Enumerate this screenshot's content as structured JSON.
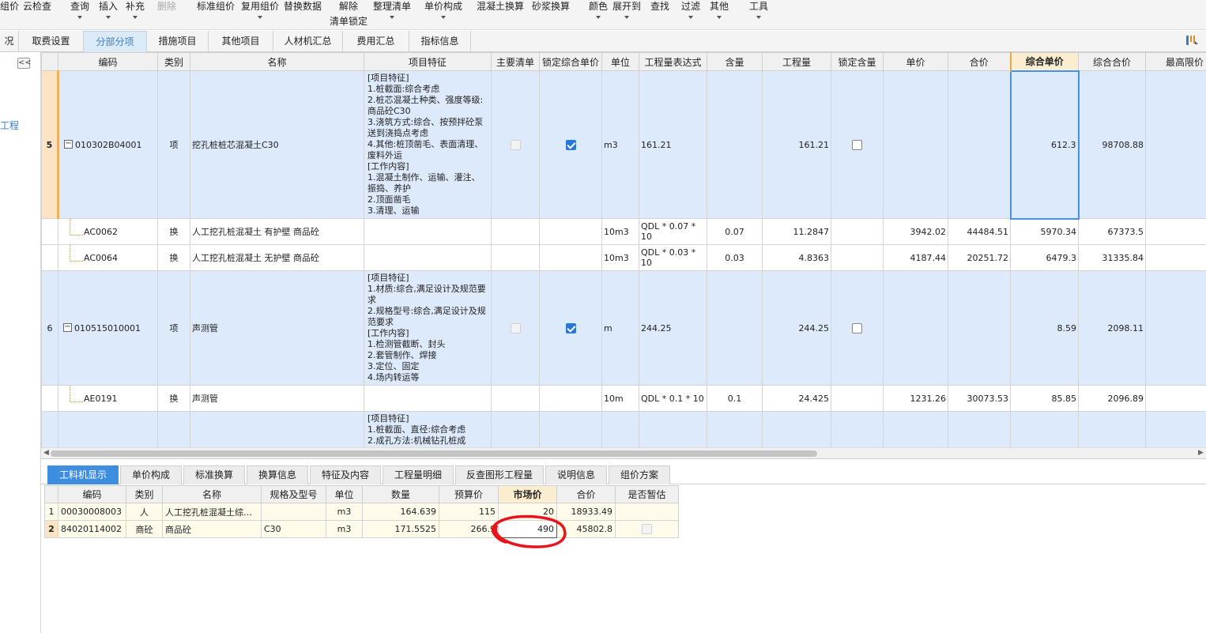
{
  "toolbar": {
    "items": [
      {
        "label": "组价",
        "dropdown": false,
        "disabled": false
      },
      {
        "label": "云检查",
        "dropdown": false,
        "disabled": false
      },
      {
        "label": "查询",
        "dropdown": true,
        "disabled": false
      },
      {
        "label": "插入",
        "dropdown": true,
        "disabled": false
      },
      {
        "label": "补充",
        "dropdown": true,
        "disabled": false
      },
      {
        "label": "删除",
        "dropdown": false,
        "disabled": true
      },
      {
        "label": "标准组价",
        "dropdown": false,
        "disabled": false
      },
      {
        "label": "复用组价",
        "dropdown": true,
        "disabled": false
      },
      {
        "label": "替换数据",
        "dropdown": false,
        "disabled": false
      },
      {
        "label": "解除",
        "dropdown": false,
        "disabled": false
      },
      {
        "label": "整理清单",
        "dropdown": true,
        "disabled": false
      },
      {
        "label": "单价构成",
        "dropdown": true,
        "disabled": false
      },
      {
        "label": "混凝土换算",
        "dropdown": false,
        "disabled": false
      },
      {
        "label": "砂浆换算",
        "dropdown": false,
        "disabled": false
      },
      {
        "label": "颜色",
        "dropdown": true,
        "disabled": false
      },
      {
        "label": "展开到",
        "dropdown": true,
        "disabled": false
      },
      {
        "label": "查找",
        "dropdown": false,
        "disabled": false
      },
      {
        "label": "过滤",
        "dropdown": true,
        "disabled": false
      },
      {
        "label": "其他",
        "dropdown": true,
        "disabled": false
      },
      {
        "label": "工具",
        "dropdown": true,
        "disabled": false
      }
    ],
    "unlock_line2": "清单锁定"
  },
  "tabs": [
    "况",
    "取费设置",
    "分部分项",
    "措施项目",
    "其他项目",
    "人材机汇总",
    "费用汇总",
    "指标信息"
  ],
  "active_tab": "分部分项",
  "left_panel": {
    "collapse": "<<",
    "text": "工程"
  },
  "main_headers": [
    "",
    "编码",
    "类别",
    "名称",
    "项目特征",
    "主要清单",
    "锁定综合单价",
    "单位",
    "工程量表达式",
    "含量",
    "工程量",
    "锁定含量",
    "单价",
    "合价",
    "综合单价",
    "综合合价",
    "最高限价"
  ],
  "rows": [
    {
      "rn": "5",
      "code": "010302B04001",
      "type": "项",
      "name": "挖孔桩桩芯混凝土C30",
      "feature": "[项目特征]\n1.桩截面:综合考虑\n2.桩芯混凝土种类、强度等级:商品砼C30\n3.浇筑方式:综合、按预拌砼泵送到浇捣点考虑\n4.其他:桩顶凿毛、表面清理、废料外运\n[工作内容]\n1.混凝土制作、运输、灌注、振捣、养护\n2.顶面凿毛\n3.清理、运输",
      "unit": "m3",
      "expr": "161.21",
      "content": "",
      "qty": "161.21",
      "price": "",
      "total": "",
      "unit_price": "612.3",
      "unit_total": "98708.88",
      "max": ""
    },
    {
      "rn": "",
      "code": "AC0062",
      "type": "换",
      "name": "人工挖孔桩混凝土 有护壁 商品砼",
      "feature": "",
      "unit": "10m3",
      "expr": "QDL * 0.07 * 10",
      "content": "0.07",
      "qty": "11.2847",
      "price": "3942.02",
      "total": "44484.51",
      "unit_price": "5970.34",
      "unit_total": "67373.5",
      "max": ""
    },
    {
      "rn": "",
      "code": "AC0064",
      "type": "换",
      "name": "人工挖孔桩混凝土 无护壁 商品砼",
      "feature": "",
      "unit": "10m3",
      "expr": "QDL * 0.03 * 10",
      "content": "0.03",
      "qty": "4.8363",
      "price": "4187.44",
      "total": "20251.72",
      "unit_price": "6479.3",
      "unit_total": "31335.84",
      "max": ""
    },
    {
      "rn": "6",
      "code": "010515010001",
      "type": "项",
      "name": "声测管",
      "feature": "[项目特征]\n1.材质:综合,满足设计及规范要求\n2.规格型号:综合,满足设计及规范要求\n[工作内容]\n1.检测管截断、封头\n2.套管制作、焊接\n3.定位、固定\n4.场内转运等",
      "unit": "m",
      "expr": "244.25",
      "content": "",
      "qty": "244.25",
      "price": "",
      "total": "",
      "unit_price": "8.59",
      "unit_total": "2098.11",
      "max": ""
    },
    {
      "rn": "",
      "code": "AE0191",
      "type": "换",
      "name": "声测管",
      "feature": "",
      "unit": "10m",
      "expr": "QDL * 0.1 * 10",
      "content": "0.1",
      "qty": "24.425",
      "price": "1231.26",
      "total": "30073.53",
      "unit_price": "85.85",
      "unit_total": "2096.89",
      "max": ""
    },
    {
      "rn": "",
      "code": "",
      "type": "",
      "name": "",
      "feature": "[项目特征]\n1.桩截面、直径:综合考虑\n2.成孔方法:机械钻孔桩成",
      "unit": "",
      "expr": "",
      "content": "",
      "qty": "",
      "price": "",
      "total": "",
      "unit_price": "",
      "unit_total": "",
      "max": ""
    }
  ],
  "bottom_tabs": [
    "工料机显示",
    "单价构成",
    "标准换算",
    "换算信息",
    "特征及内容",
    "工程量明细",
    "反查图形工程量",
    "说明信息",
    "组价方案"
  ],
  "active_bottom_tab": "工料机显示",
  "sub_headers": [
    "",
    "编码",
    "类别",
    "名称",
    "规格及型号",
    "单位",
    "数量",
    "预算价",
    "市场价",
    "合价",
    "是否暂估"
  ],
  "sub_rows": [
    {
      "rn": "1",
      "code": "00030008003",
      "type": "人",
      "name": "人工挖孔桩混凝土综…",
      "spec": "",
      "unit": "m3",
      "qty": "164.639",
      "budget": "115",
      "market": "20",
      "total": "18933.49"
    },
    {
      "rn": "2",
      "code": "84020114002",
      "type": "商砼",
      "name": "商品砼",
      "spec": "C30",
      "unit": "m3",
      "qty": "171.5525",
      "budget": "266.9",
      "market": "490",
      "total": "45802.8"
    }
  ],
  "colors": {
    "accent": "#3d8ee0",
    "selected_row": "#ddeafb",
    "header_highlight": "#fbeed0",
    "annotation": "#e8141c"
  }
}
